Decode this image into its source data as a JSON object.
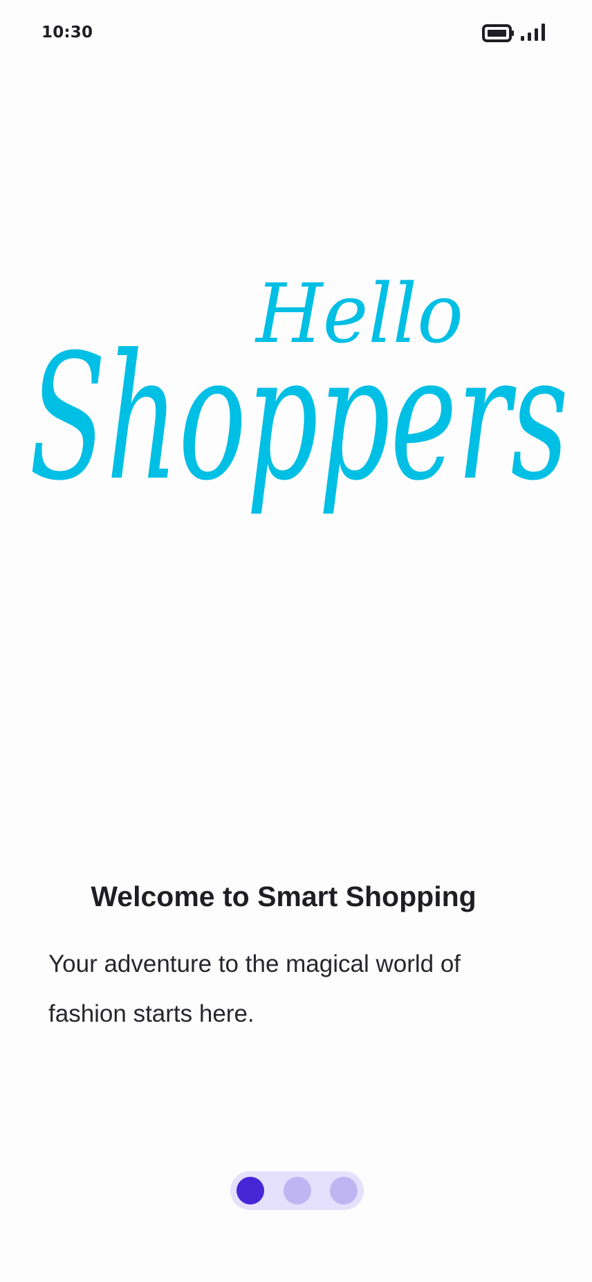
{
  "status_bar": {
    "time": "10:30",
    "icons": [
      "battery-icon",
      "signal-icon"
    ]
  },
  "logo": {
    "line1": "Hello",
    "line2": "Shoppers",
    "color": "#00BFE4"
  },
  "onboarding": {
    "title": "Welcome to Smart Shopping",
    "description_line1": "Your adventure to the magical world of",
    "description_line2": "fashion starts here."
  },
  "pager": {
    "total_pages": 3,
    "current_page": 1,
    "active_color": "#4527D5",
    "inactive_color": "#C0B5F3",
    "track_color": "#E5E0FC"
  }
}
